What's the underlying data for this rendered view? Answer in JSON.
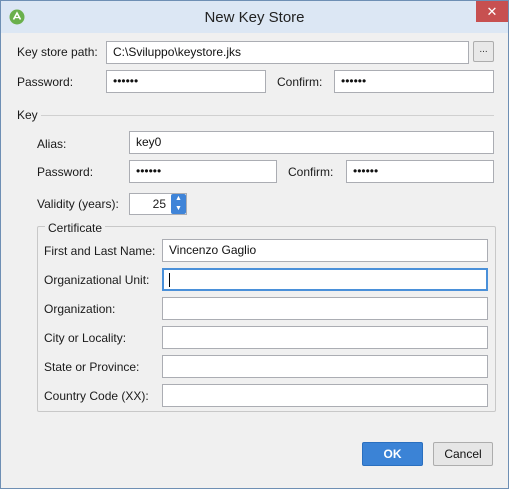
{
  "window": {
    "title": "New Key Store",
    "close_glyph": "✕",
    "icon": "android-studio-icon"
  },
  "keystore": {
    "path_label": "Key store path:",
    "path_value": "C:\\Sviluppo\\keystore.jks",
    "browse_label": "...",
    "password_label": "Password:",
    "password_value": "••••••",
    "confirm_label": "Confirm:",
    "confirm_value": "••••••"
  },
  "key": {
    "section_label": "Key",
    "alias_label": "Alias:",
    "alias_value": "key0",
    "password_label": "Password:",
    "password_value": "••••••",
    "confirm_label": "Confirm:",
    "confirm_value": "••••••",
    "validity_label": "Validity (years):",
    "validity_value": "25"
  },
  "certificate": {
    "group_label": "Certificate",
    "first_last_name_label": "First and Last Name:",
    "first_last_name_value": "Vincenzo Gaglio",
    "org_unit_label": "Organizational Unit:",
    "org_unit_value": "",
    "organization_label": "Organization:",
    "organization_value": "",
    "city_label": "City or Locality:",
    "city_value": "",
    "state_label": "State or Province:",
    "state_value": "",
    "country_label": "Country Code (XX):",
    "country_value": ""
  },
  "buttons": {
    "ok_label": "OK",
    "cancel_label": "Cancel"
  },
  "colors": {
    "accent": "#3b83d6",
    "focus_border": "#4a90d9",
    "close": "#c75050"
  }
}
